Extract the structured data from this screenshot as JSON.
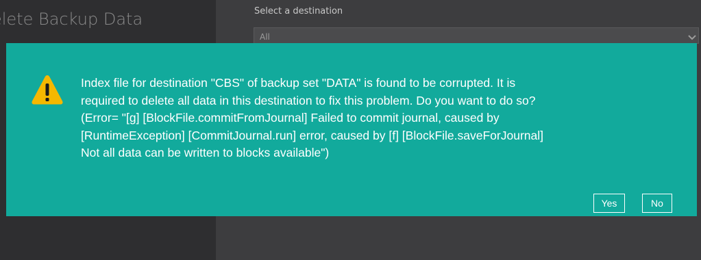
{
  "background": {
    "panel_title": "elete Backup Data",
    "destination_label": "Select a destination",
    "destination_value": "All"
  },
  "dialog": {
    "icon": "warning-icon",
    "message_lines": [
      "Index file for destination \"CBS\" of backup set \"DATA\" is found to be corrupted. It is",
      "required to delete all data in this destination to fix this problem. Do you want to do so?",
      "(Error= \"[g] [BlockFile.commitFromJournal] Failed to commit journal, caused by",
      "[RuntimeException] [CommitJournal.run] error, caused by [f] [BlockFile.saveForJournal]",
      "Not all data can be written to blocks available\")"
    ],
    "yes_label": "Yes",
    "no_label": "No"
  },
  "colors": {
    "dialog_bg": "#12aa9c",
    "warning": "#f5b800",
    "overlay_dark": "#2e2e30"
  }
}
